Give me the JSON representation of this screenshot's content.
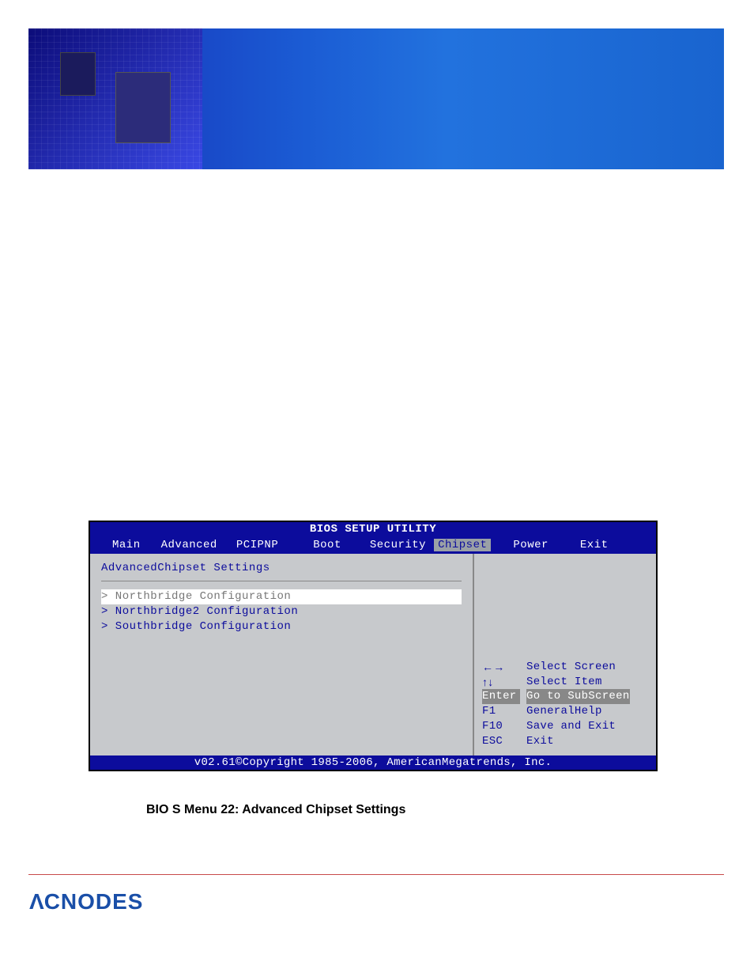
{
  "bios": {
    "utility_title": "BIOS SETUP UTILITY",
    "tabs": {
      "main": "Main",
      "advanced": "Advanced",
      "pcipnp": "PCIPNP",
      "boot": "Boot",
      "security": "Security",
      "chipset": "Chipset",
      "power": "Power",
      "exit": "Exit"
    },
    "section_title": "AdvancedChipset Settings",
    "items": {
      "nb": "> Northbridge Configuration",
      "nb2": "> Northbridge2 Configuration",
      "sb": "> Southbridge Configuration"
    },
    "help": {
      "lr_key": "←→",
      "lr_text": "Select Screen",
      "ud_key": "↑↓",
      "ud_text": "Select Item",
      "enter_key": "Enter",
      "enter_text": "Go to SubScreen",
      "f1_key": "F1",
      "f1_text": "GeneralHelp",
      "f10_key": "F10",
      "f10_text": "Save and Exit",
      "esc_key": "ESC",
      "esc_text": "Exit"
    },
    "footer": "v02.61©Copyright 1985-2006, AmericanMegatrends, Inc."
  },
  "caption": "BIO S Menu 22: Advanced Chipset Settings",
  "brand": "CNODES"
}
